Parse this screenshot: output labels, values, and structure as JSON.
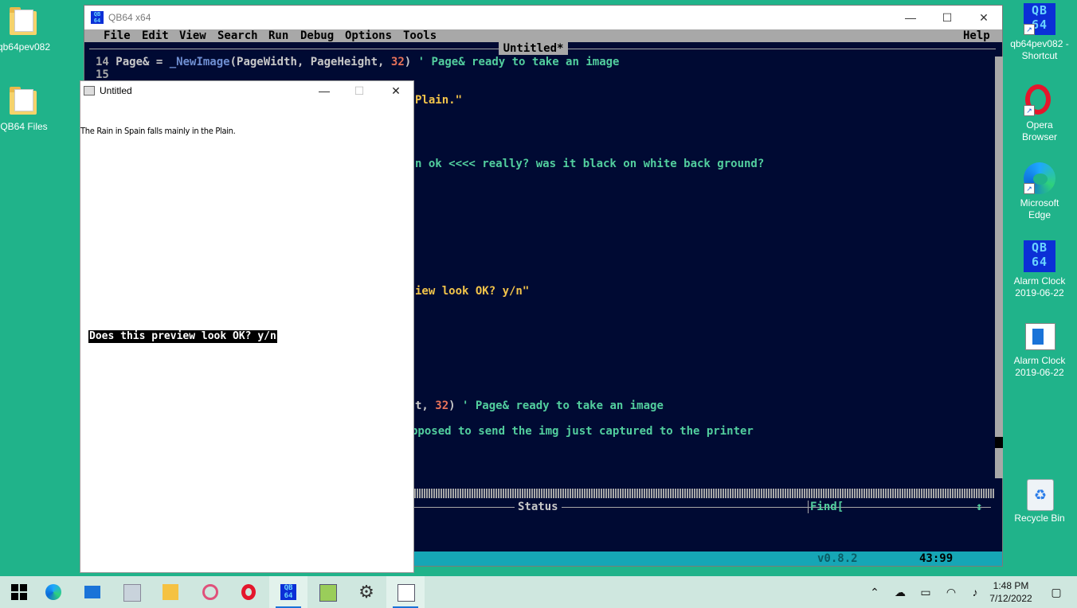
{
  "desktop": {
    "icons_left": [
      {
        "label": "qb64pev082",
        "icon": "folder-icon"
      },
      {
        "label": "QB64 Files",
        "icon": "folder-icon"
      }
    ],
    "icons_right": [
      {
        "label": "qb64pev082 - Shortcut",
        "icon": "qb64-icon"
      },
      {
        "label": "Opera Browser",
        "icon": "opera-icon"
      },
      {
        "label": "Microsoft Edge",
        "icon": "edge-icon"
      },
      {
        "label": "Alarm Clock 2019-06-22",
        "icon": "qb64-icon"
      },
      {
        "label": "Alarm Clock 2019-06-22",
        "icon": "notepad-icon"
      },
      {
        "label": "Recycle Bin",
        "icon": "recycle-bin-icon"
      }
    ]
  },
  "ide": {
    "window_title": "QB64 x64",
    "logo_text": "QB64",
    "menu": [
      "File",
      "Edit",
      "View",
      "Search",
      "Run",
      "Debug",
      "Options",
      "Tools"
    ],
    "help": "Help",
    "file_title": "Untitled*",
    "line14": {
      "num": "14",
      "a": "Page& = ",
      "fn": "_NewImage",
      "b": "(PageWidth, PageHeight, ",
      "n": "32",
      "c": ")",
      "comment": " ' Page& ready to take an image"
    },
    "line15": {
      "num": "15"
    },
    "frag_plain": "Plain.\"",
    "frag_ok": "n ok <<<< really? was it black on white back ground?",
    "frag_preview": "iew look OK? y/n\"",
    "frag_page_a": "t, ",
    "frag_page_n": "32",
    "frag_page_b": ")",
    "frag_page_comment": " ' Page& ready to take an image",
    "frag_printer": "pposed to send the img just captured to the printer",
    "status_label": "Status",
    "find_label": "Find[",
    "find_arrows": "↕",
    "version": "v0.8.2",
    "cursor_pos": "43:99"
  },
  "program": {
    "window_title": "Untitled",
    "text_line": "The Rain in Spain falls mainly in the Plain.",
    "prompt": "Does this preview look OK? y/n"
  },
  "taskbar": {
    "apps": [
      "start-icon",
      "edge-icon",
      "mail-icon",
      "photos-icon",
      "file-explorer-icon",
      "snip-icon",
      "opera-icon",
      "qb64-icon",
      "notepad-icon",
      "settings-icon",
      "program-window-icon"
    ],
    "time": "1:48 PM",
    "date": "7/12/2022"
  }
}
